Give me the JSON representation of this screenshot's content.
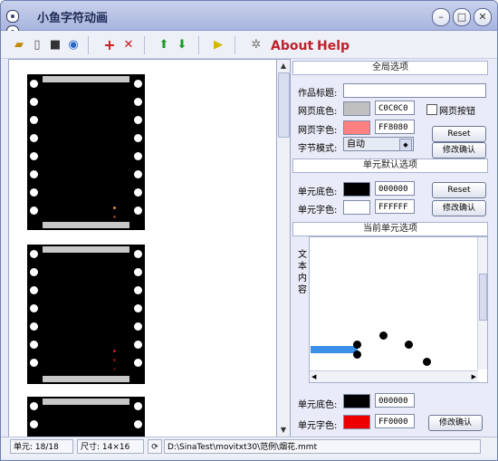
{
  "window": {
    "title": "小鱼字符动画"
  },
  "menu": {
    "about": "About",
    "help": "Help"
  },
  "toolbar": {
    "icons": [
      "open-folder-icon",
      "new-file-icon",
      "save-icon",
      "web-icon",
      "add-icon",
      "delete-icon",
      "move-up-icon",
      "move-down-icon",
      "play-icon",
      "settings-icon"
    ],
    "add_glyph": "+",
    "delete_glyph": "✕",
    "up_glyph": "⬆",
    "down_glyph": "⬇",
    "play_glyph": "▶",
    "settings_glyph": "✲"
  },
  "global_options": {
    "title": "全局选项",
    "work_title_label": "作品标题:",
    "work_title_value": "",
    "page_bg_label": "网页底色:",
    "page_bg_value": "C0C0C0",
    "page_bg_color": "#c0c0c0",
    "page_fg_label": "网页字色:",
    "page_fg_value": "FF8080",
    "page_fg_color": "#ff8080",
    "web_button_label": "网页按钮",
    "byte_mode_label": "字节模式:",
    "byte_mode_value": "自动",
    "reset": "Reset",
    "confirm": "修改确认"
  },
  "cell_defaults": {
    "title": "单元默认选项",
    "bg_label": "单元底色:",
    "bg_value": "000000",
    "bg_color": "#000000",
    "fg_label": "单元字色:",
    "fg_value": "FFFFFF",
    "fg_color": "#ffffff",
    "reset": "Reset",
    "confirm": "修改确认"
  },
  "current_cell": {
    "title": "当前单元选项",
    "text_content_label": "文本内容",
    "bg_label": "单元底色:",
    "bg_value": "000000",
    "bg_color": "#000000",
    "fg_label": "单元字色:",
    "fg_value": "FF0000",
    "fg_color": "#ee0000",
    "confirm": "修改确认"
  },
  "status": {
    "cell": "单元: 18/18",
    "size": "尺寸: 14×16",
    "path": "D:\\SinaTest\\movitxt30\\范例\\烟花.mmt"
  }
}
